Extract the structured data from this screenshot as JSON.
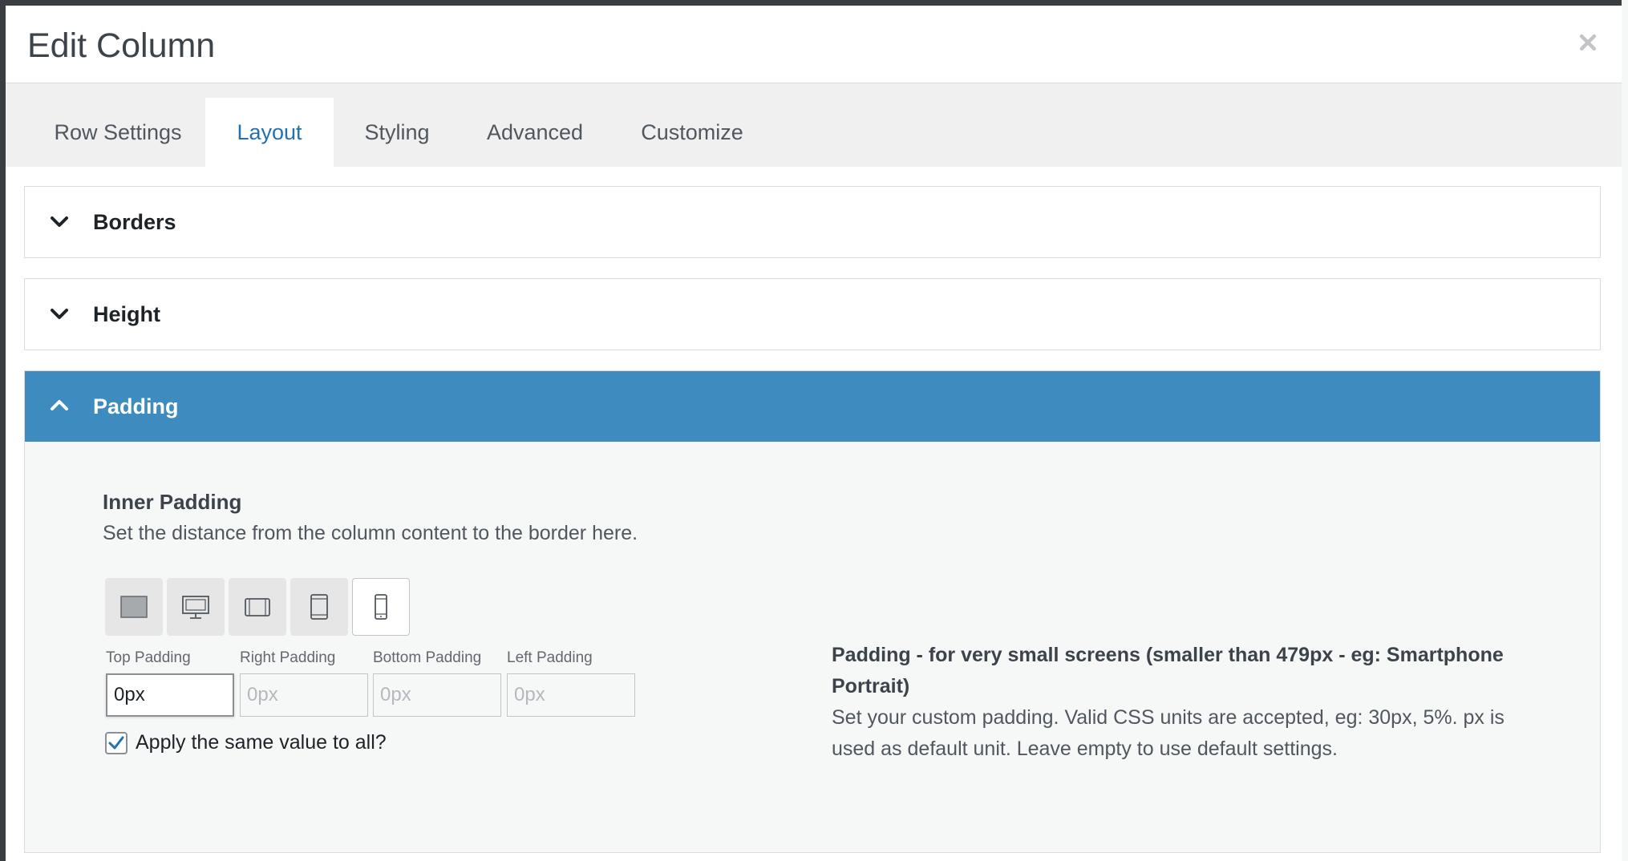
{
  "modal": {
    "title": "Edit Column"
  },
  "tabs": [
    {
      "label": "Row Settings",
      "active": false
    },
    {
      "label": "Layout",
      "active": true
    },
    {
      "label": "Styling",
      "active": false
    },
    {
      "label": "Advanced",
      "active": false
    },
    {
      "label": "Customize",
      "active": false
    }
  ],
  "sections": {
    "borders": {
      "label": "Borders",
      "expanded": false
    },
    "height": {
      "label": "Height",
      "expanded": false
    },
    "padding": {
      "label": "Padding",
      "expanded": true
    }
  },
  "padding": {
    "title": "Inner Padding",
    "description": "Set the distance from the column content to the border here.",
    "devices": [
      {
        "icon": "desktop-wide-icon",
        "active": false
      },
      {
        "icon": "monitor-icon",
        "active": false
      },
      {
        "icon": "tablet-landscape-icon",
        "active": false
      },
      {
        "icon": "tablet-portrait-icon",
        "active": false
      },
      {
        "icon": "smartphone-icon",
        "active": true
      }
    ],
    "fields": {
      "top": {
        "label": "Top Padding",
        "value": "0px",
        "placeholder": "0px"
      },
      "right": {
        "label": "Right Padding",
        "value": "",
        "placeholder": "0px"
      },
      "bottom": {
        "label": "Bottom Padding",
        "value": "",
        "placeholder": "0px"
      },
      "left": {
        "label": "Left Padding",
        "value": "",
        "placeholder": "0px"
      }
    },
    "apply_all": {
      "label": "Apply the same value to all?",
      "checked": true
    },
    "help_title": "Padding - for very small screens (smaller than 479px - eg: Smartphone Portrait)",
    "help_text": "Set your custom padding. Valid CSS units are accepted, eg: 30px, 5%. px is used as default unit. Leave empty to use default settings."
  },
  "colors": {
    "accent": "#3d8bbf",
    "tab_active": "#2271b1"
  }
}
